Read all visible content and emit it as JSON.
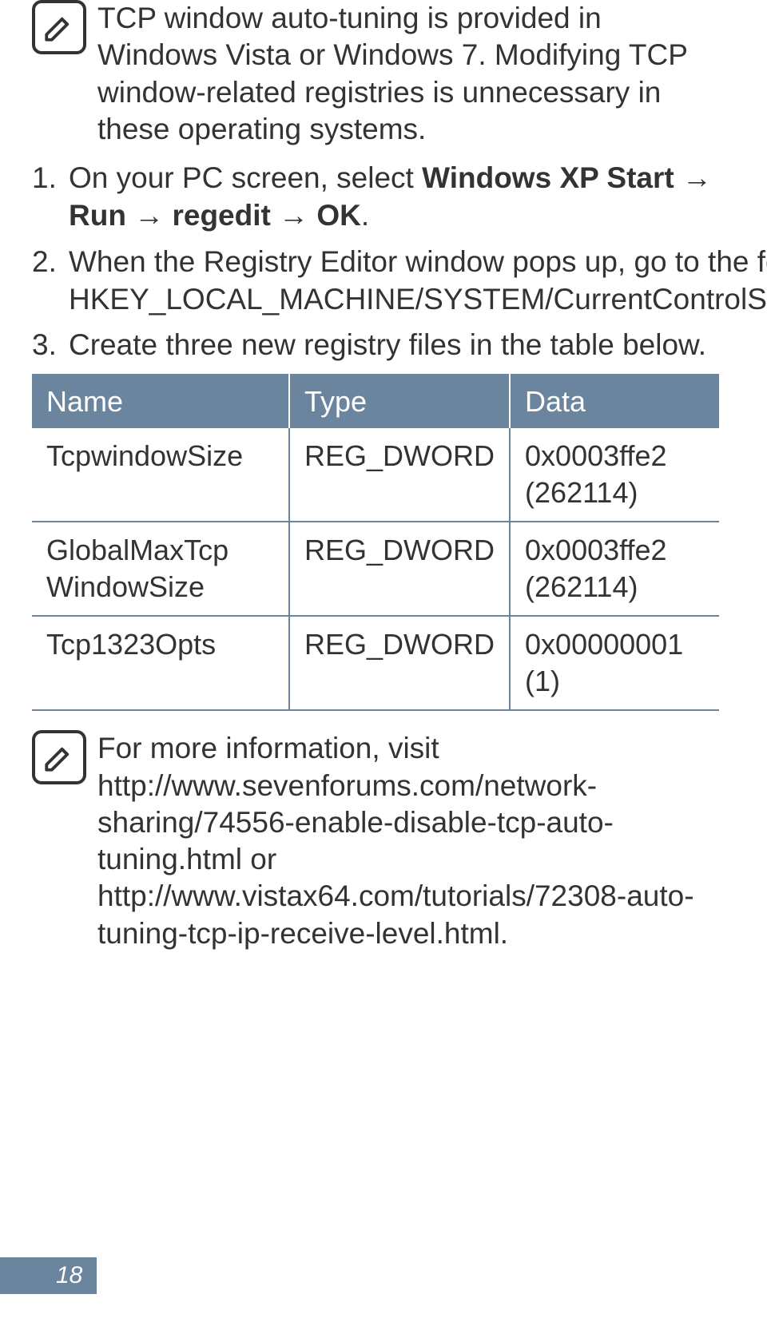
{
  "note1": "TCP window auto-tuning is provided in Windows Vista or Windows 7. Modifying TCP window-related registries is unnecessary in these operating systems.",
  "steps": [
    {
      "n": "1.",
      "pre": "On your PC screen, select ",
      "bold": "Windows XP Start → Run → regedit → OK",
      "post": "."
    },
    {
      "n": "2.",
      "pre": "When the Registry Editor window pops up, go to the following location:  HKEY_LOCAL_MACHINE/SYSTEM/CurrentControlSet/Services/Tcpip/Parameters.",
      "bold": "",
      "post": ""
    },
    {
      "n": "3.",
      "pre": "Create three new registry files in the table below.",
      "bold": "",
      "post": ""
    }
  ],
  "headers": {
    "c1": "Name",
    "c2": "Type",
    "c3": "Data"
  },
  "rows": [
    {
      "name": "TcpwindowSize",
      "type": "REG_DWORD",
      "data": "0x0003ffe2 (262114)"
    },
    {
      "name": "GlobalMaxTcp WindowSize",
      "type": "REG_DWORD",
      "data": "0x0003ffe2 (262114)"
    },
    {
      "name": "Tcp1323Opts",
      "type": "REG_DWORD",
      "data": "0x00000001 (1)"
    }
  ],
  "note2": "For more information, visit http://www.sevenforums.com/network-sharing/74556-enable-disable-tcp-auto-tuning.html or http://www.vistax64.com/tutorials/72308-auto-tuning-tcp-ip-receive-level.html.",
  "pageNumber": "18"
}
